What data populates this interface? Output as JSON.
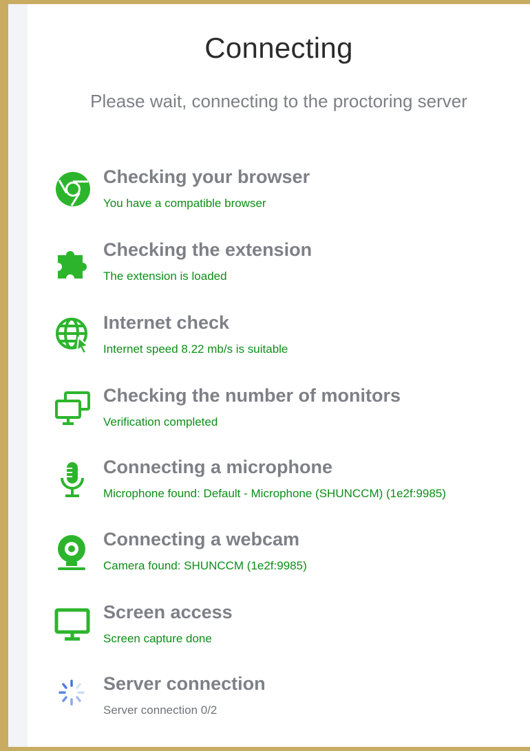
{
  "title": "Connecting",
  "subtitle": "Please wait, connecting to the proctoring server",
  "accent_color": "#2cb52c",
  "status_ok_color": "#0d8e17",
  "spinner_color": "#3c6fe0",
  "checks": [
    {
      "icon": "chrome-icon",
      "label": "Checking your browser",
      "status": "You have a compatible browser"
    },
    {
      "icon": "puzzle-icon",
      "label": "Checking the extension",
      "status": "The extension is loaded"
    },
    {
      "icon": "globe-icon",
      "label": "Internet check",
      "status": "Internet speed 8.22 mb/s is suitable"
    },
    {
      "icon": "monitors-icon",
      "label": "Checking the number of monitors",
      "status": "Verification completed"
    },
    {
      "icon": "microphone-icon",
      "label": "Connecting a microphone",
      "status": "Microphone found: Default - Microphone (SHUNCCM) (1e2f:9985)"
    },
    {
      "icon": "webcam-icon",
      "label": "Connecting a webcam",
      "status": "Camera found: SHUNCCM (1e2f:9985)"
    },
    {
      "icon": "screen-icon",
      "label": "Screen access",
      "status": "Screen capture done"
    },
    {
      "icon": "spinner-icon",
      "label": "Server connection",
      "status": "Server connection 0/2"
    }
  ]
}
